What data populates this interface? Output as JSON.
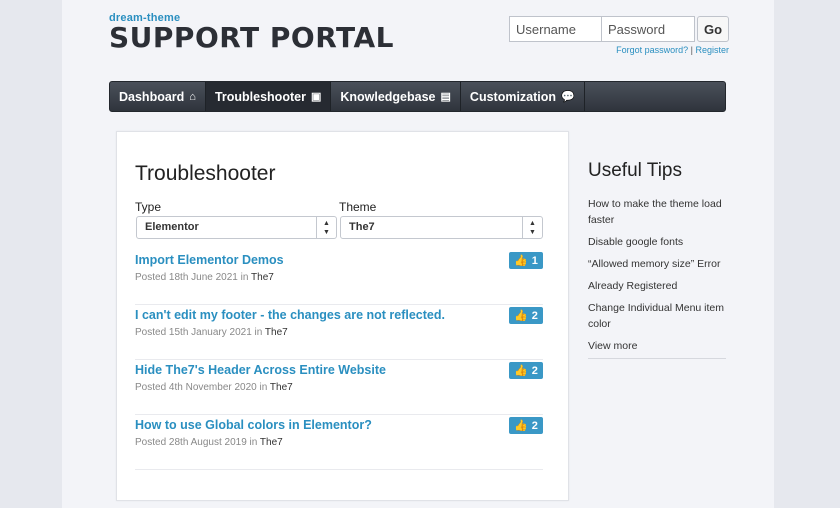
{
  "brand": {
    "subtitle": "dream-theme",
    "title": "SUPPORT PORTAL"
  },
  "login": {
    "username_placeholder": "Username",
    "password_placeholder": "Password",
    "go_label": "Go",
    "forgot_label": "Forgot password?",
    "separator": " | ",
    "register_label": "Register"
  },
  "nav": {
    "items": [
      {
        "label": "Dashboard",
        "icon": "home-icon",
        "glyph": "⌂"
      },
      {
        "label": "Troubleshooter",
        "icon": "toolbox-icon",
        "glyph": "▣"
      },
      {
        "label": "Knowledgebase",
        "icon": "book-icon",
        "glyph": "▤"
      },
      {
        "label": "Customization",
        "icon": "chat-icon",
        "glyph": "💬"
      }
    ],
    "active_index": 1
  },
  "main": {
    "title": "Troubleshooter",
    "type_label": "Type",
    "type_value": "Elementor",
    "theme_label": "Theme",
    "theme_value": "The7",
    "posts": [
      {
        "title": "Import Elementor Demos",
        "posted_prefix": "Posted 18th June 2021 in ",
        "theme": "The7",
        "votes": "1"
      },
      {
        "title": "I can't edit my footer - the changes are not reflected.",
        "posted_prefix": "Posted 15th January 2021 in ",
        "theme": "The7",
        "votes": "2"
      },
      {
        "title": "Hide The7's Header Across Entire Website",
        "posted_prefix": "Posted 4th November 2020 in ",
        "theme": "The7",
        "votes": "2"
      },
      {
        "title": "How to use Global colors in Elementor?",
        "posted_prefix": "Posted 28th August 2019 in ",
        "theme": "The7",
        "votes": "2"
      }
    ]
  },
  "sidebar": {
    "title": "Useful Tips",
    "tips": [
      "How to make the theme load faster",
      "Disable google fonts",
      "“Allowed memory size” Error",
      "Already Registered",
      "Change Individual Menu item color",
      "View more"
    ]
  }
}
